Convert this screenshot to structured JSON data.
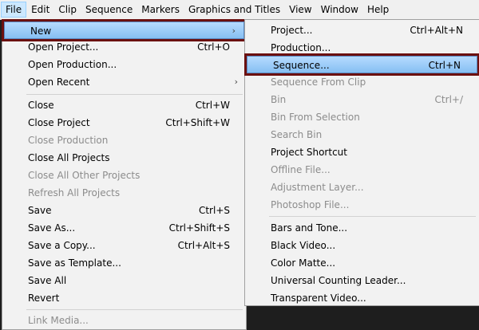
{
  "menubar": {
    "items": [
      "File",
      "Edit",
      "Clip",
      "Sequence",
      "Markers",
      "Graphics and Titles",
      "View",
      "Window",
      "Help"
    ]
  },
  "file_menu": {
    "items": [
      {
        "label": "New",
        "shortcut": "",
        "submenu": true,
        "enabled": true
      },
      {
        "label": "Open Project...",
        "shortcut": "Ctrl+O",
        "enabled": true
      },
      {
        "label": "Open Production...",
        "shortcut": "",
        "enabled": true
      },
      {
        "label": "Open Recent",
        "shortcut": "",
        "submenu": true,
        "enabled": true
      },
      {
        "label": "Close",
        "shortcut": "Ctrl+W",
        "enabled": true
      },
      {
        "label": "Close Project",
        "shortcut": "Ctrl+Shift+W",
        "enabled": true
      },
      {
        "label": "Close Production",
        "shortcut": "",
        "enabled": false
      },
      {
        "label": "Close All Projects",
        "shortcut": "",
        "enabled": true
      },
      {
        "label": "Close All Other Projects",
        "shortcut": "",
        "enabled": false
      },
      {
        "label": "Refresh All Projects",
        "shortcut": "",
        "enabled": false
      },
      {
        "label": "Save",
        "shortcut": "Ctrl+S",
        "enabled": true
      },
      {
        "label": "Save As...",
        "shortcut": "Ctrl+Shift+S",
        "enabled": true
      },
      {
        "label": "Save a Copy...",
        "shortcut": "Ctrl+Alt+S",
        "enabled": true
      },
      {
        "label": "Save as Template...",
        "shortcut": "",
        "enabled": true
      },
      {
        "label": "Save All",
        "shortcut": "",
        "enabled": true
      },
      {
        "label": "Revert",
        "shortcut": "",
        "enabled": true
      },
      {
        "label": "Link Media...",
        "shortcut": "",
        "enabled": false
      }
    ]
  },
  "new_menu": {
    "items": [
      {
        "label": "Project...",
        "shortcut": "Ctrl+Alt+N",
        "enabled": true
      },
      {
        "label": "Production...",
        "shortcut": "",
        "enabled": true
      },
      {
        "label": "Sequence...",
        "shortcut": "Ctrl+N",
        "enabled": true
      },
      {
        "label": "Sequence From Clip",
        "shortcut": "",
        "enabled": false
      },
      {
        "label": "Bin",
        "shortcut": "Ctrl+/",
        "enabled": false
      },
      {
        "label": "Bin From Selection",
        "shortcut": "",
        "enabled": false
      },
      {
        "label": "Search Bin",
        "shortcut": "",
        "enabled": false
      },
      {
        "label": "Project Shortcut",
        "shortcut": "",
        "enabled": true
      },
      {
        "label": "Offline File...",
        "shortcut": "",
        "enabled": false
      },
      {
        "label": "Adjustment Layer...",
        "shortcut": "",
        "enabled": false
      },
      {
        "label": "Photoshop File...",
        "shortcut": "",
        "enabled": false
      },
      {
        "label": "Bars and Tone...",
        "shortcut": "",
        "enabled": true
      },
      {
        "label": "Black Video...",
        "shortcut": "",
        "enabled": true
      },
      {
        "label": "Color Matte...",
        "shortcut": "",
        "enabled": true
      },
      {
        "label": "Universal Counting Leader...",
        "shortcut": "",
        "enabled": true
      },
      {
        "label": "Transparent Video...",
        "shortcut": "",
        "enabled": true
      }
    ]
  }
}
